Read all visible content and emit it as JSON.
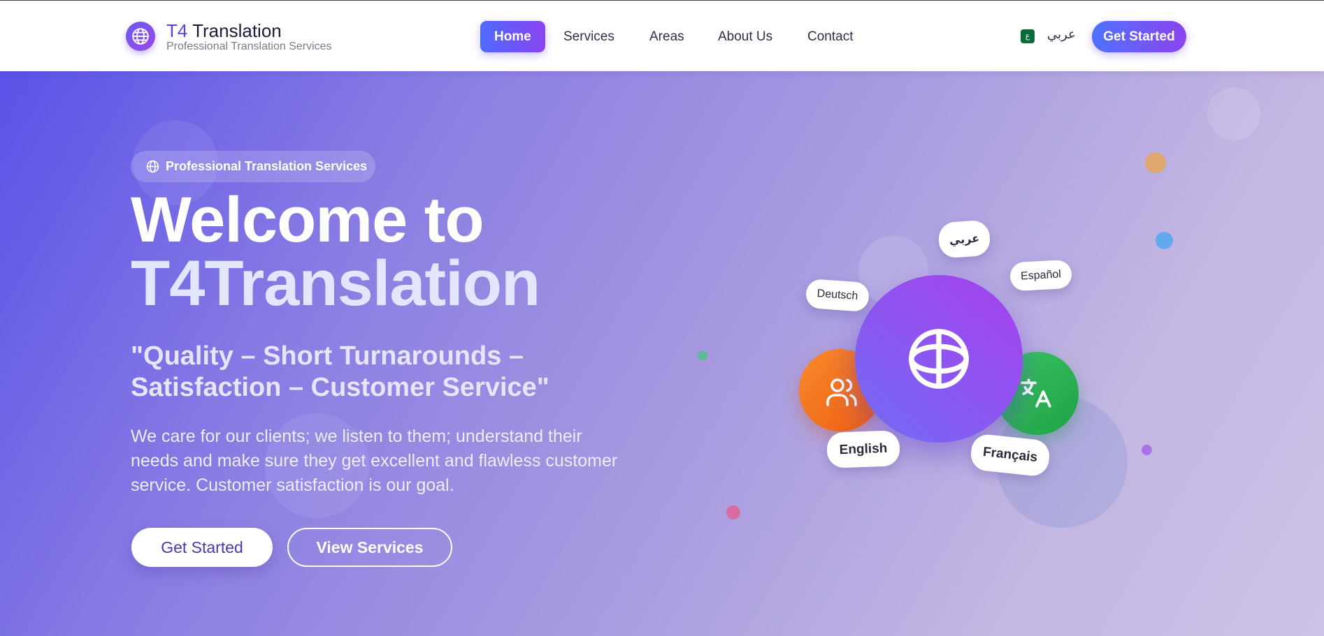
{
  "brand": {
    "title_accent": "T4",
    "title_rest": " Translation",
    "subtitle": "Professional Translation Services"
  },
  "nav": {
    "items": [
      {
        "label": "Home",
        "active": true
      },
      {
        "label": "Services",
        "active": false
      },
      {
        "label": "Areas",
        "active": false
      },
      {
        "label": "About Us",
        "active": false
      },
      {
        "label": "Contact",
        "active": false
      }
    ],
    "lang_badge": "ع",
    "lang_switch": "عربي",
    "cta": "Get Started"
  },
  "hero": {
    "pill": "Professional Translation Services",
    "headline_1": "Welcome to",
    "headline_2": "T4Translation",
    "tagline": "\"Quality – Short Turnarounds – Satisfaction – Customer Service\"",
    "description": "We care for our clients; we listen to them; understand their needs and make sure they get excellent and flawless customer service. Customer satisfaction is our goal.",
    "primary_button": "Get Started",
    "secondary_button": "View Services"
  },
  "illustration": {
    "languages": [
      "عربي",
      "Español",
      "Deutsch",
      "English",
      "Français"
    ],
    "icons": [
      "globe-icon",
      "users-icon",
      "translate-icon"
    ]
  },
  "colors": {
    "brand_accent": "#5b3ff0",
    "button_gradient_start": "#4d6bff",
    "button_gradient_end": "#8a43f0",
    "hero_start": "#5b52e8",
    "hero_end": "#cdc2e5",
    "orange": "#f06a16",
    "green": "#22b24c",
    "purple": "#9b3ff0"
  }
}
